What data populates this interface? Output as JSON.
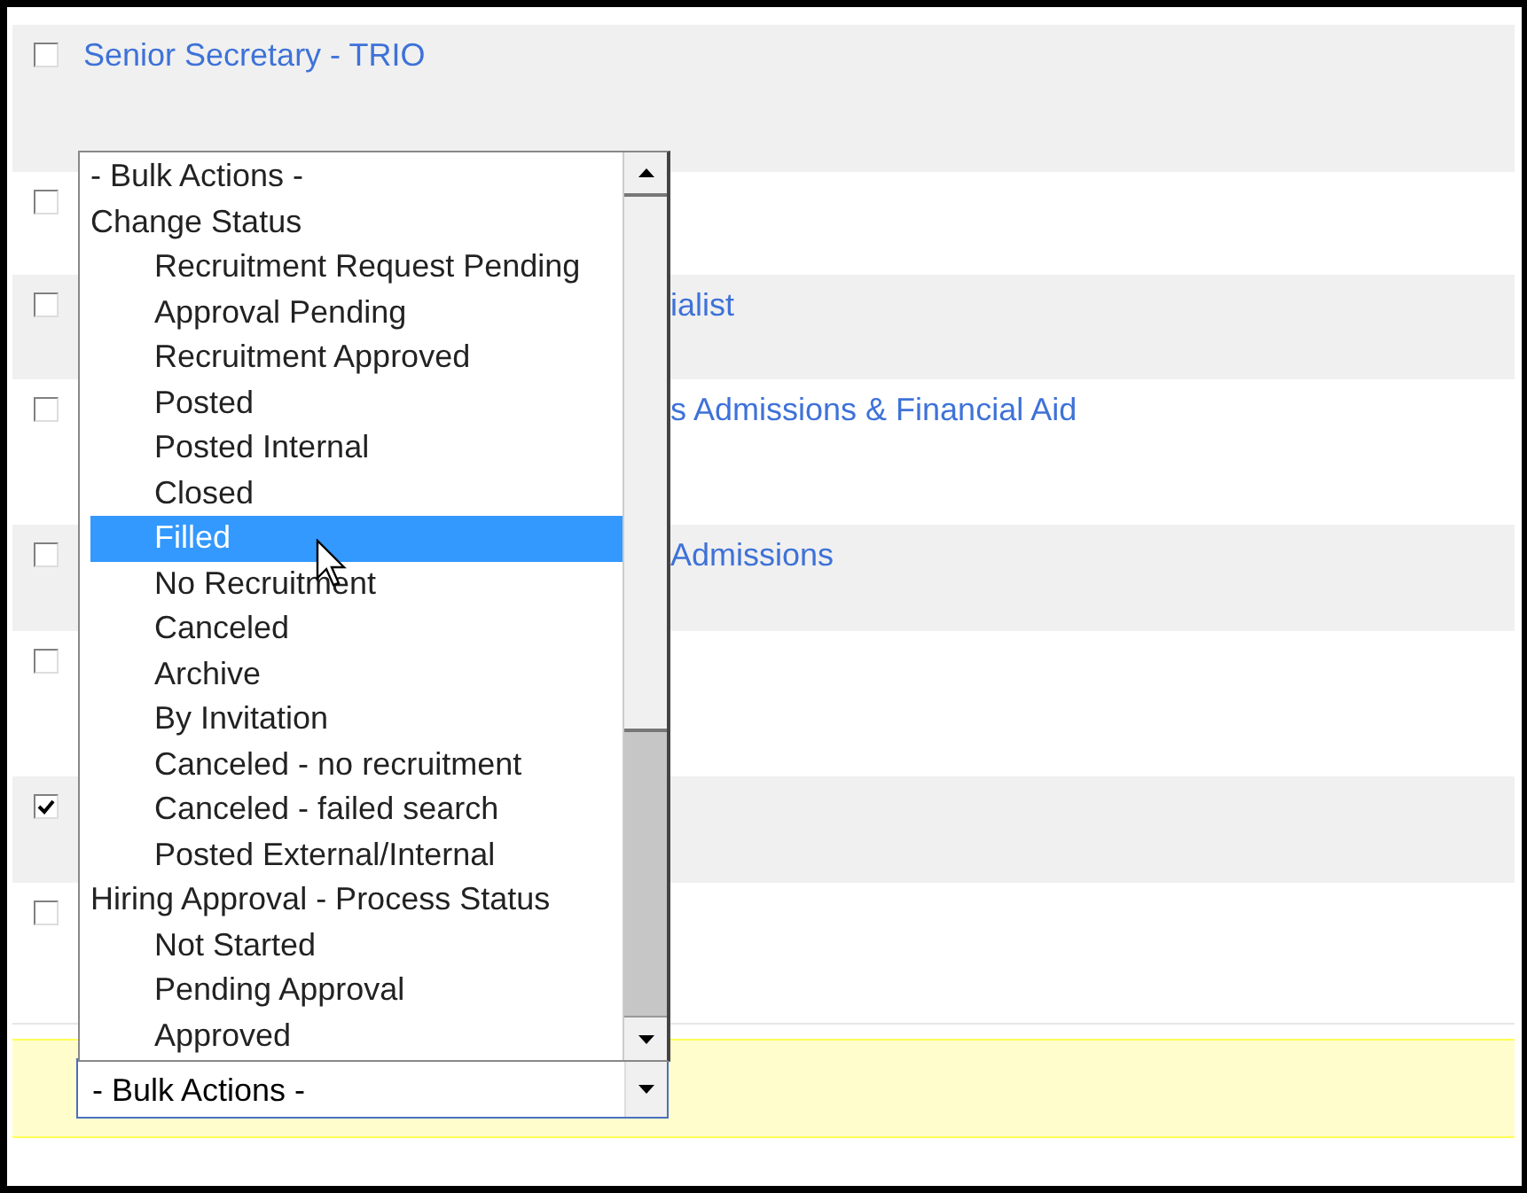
{
  "rows": [
    {
      "checked": false,
      "title": "Senior Secretary - TRIO"
    },
    {
      "checked": false
    },
    {
      "checked": false,
      "title": "ialist"
    },
    {
      "checked": false,
      "title": "s Admissions & Financial Aid"
    },
    {
      "checked": false,
      "title": "Admissions"
    },
    {
      "checked": false
    },
    {
      "checked": true
    },
    {
      "checked": false
    }
  ],
  "bulk_actions_list": {
    "first_option": {
      "label": "- Bulk Actions -",
      "selected": false
    },
    "groups": [
      {
        "label": "Change Status",
        "options": [
          {
            "label": "Recruitment Request Pending",
            "selected": false
          },
          {
            "label": "Approval Pending",
            "selected": false
          },
          {
            "label": "Recruitment Approved",
            "selected": false
          },
          {
            "label": "Posted",
            "selected": false
          },
          {
            "label": "Posted Internal",
            "selected": false
          },
          {
            "label": "Closed",
            "selected": false
          },
          {
            "label": "Filled",
            "selected": true
          },
          {
            "label": "No Recruitment",
            "selected": false
          },
          {
            "label": "Canceled",
            "selected": false
          },
          {
            "label": "Archive",
            "selected": false
          },
          {
            "label": "By Invitation",
            "selected": false
          },
          {
            "label": "Canceled - no recruitment",
            "selected": false
          },
          {
            "label": "Canceled - failed search",
            "selected": false
          },
          {
            "label": "Posted External/Internal",
            "selected": false
          }
        ]
      },
      {
        "label": "Hiring Approval - Process Status",
        "options": [
          {
            "label": "Not Started",
            "selected": false
          },
          {
            "label": "Pending Approval",
            "selected": false
          },
          {
            "label": "Approved",
            "selected": false
          }
        ]
      }
    ]
  },
  "bulk_actions_select": {
    "value": "- Bulk Actions -"
  }
}
